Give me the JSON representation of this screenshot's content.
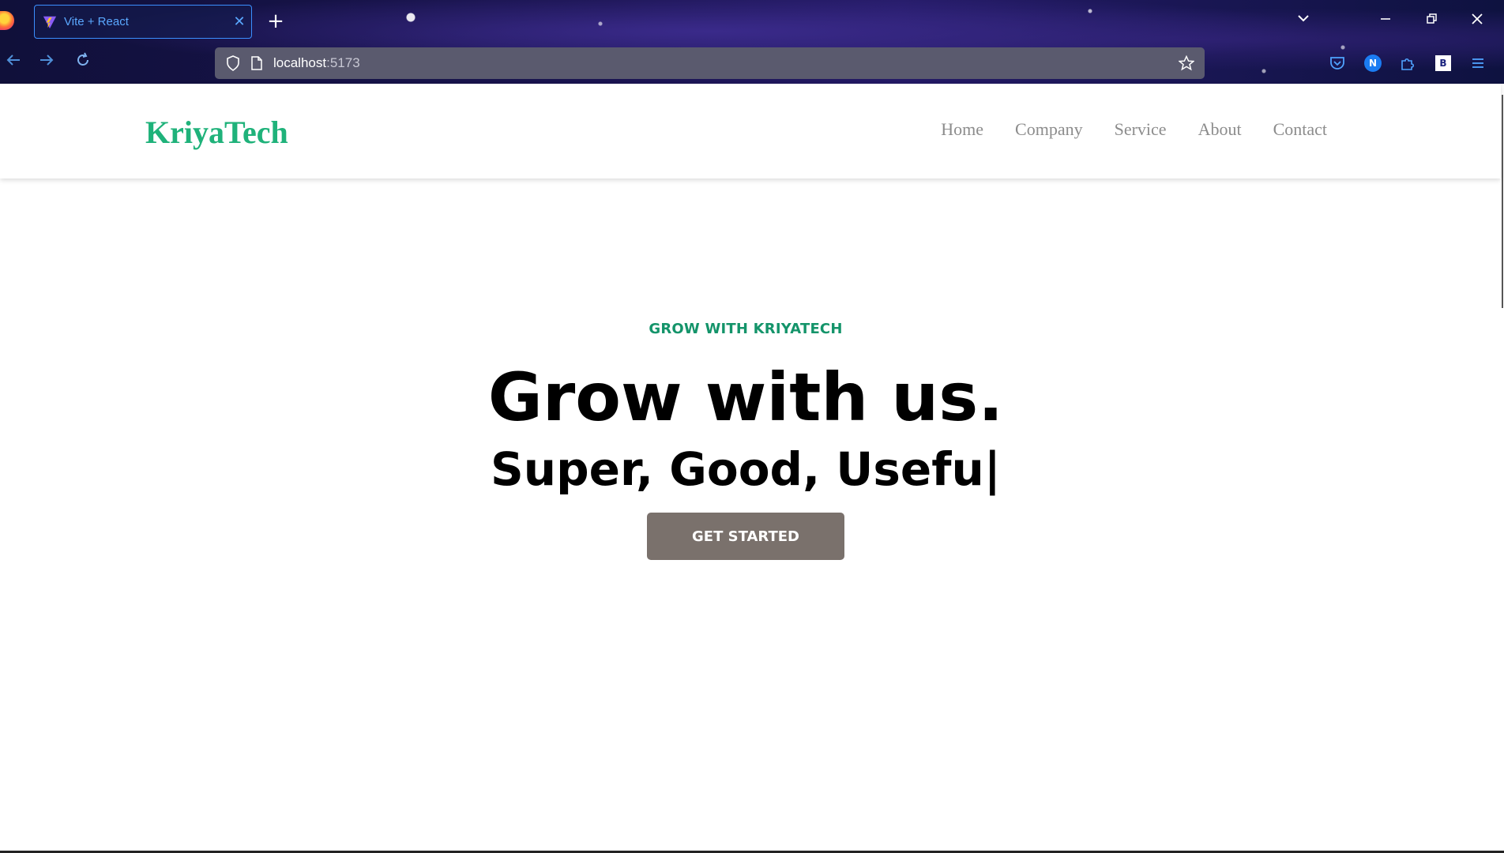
{
  "browser": {
    "tab": {
      "title": "Vite + React",
      "favicon": "vite-icon",
      "close_glyph": "✕"
    },
    "new_tab_glyph": "+",
    "url": {
      "host": "localhost",
      "port": ":5173"
    },
    "extensions": {
      "n_badge": "N",
      "b_badge": "B"
    },
    "accent_color": "#3b8fff"
  },
  "site": {
    "brand": "KriyaTech",
    "brand_color": "#1fb27a",
    "nav": [
      {
        "label": "Home"
      },
      {
        "label": "Company"
      },
      {
        "label": "Service"
      },
      {
        "label": "About"
      },
      {
        "label": "Contact"
      }
    ]
  },
  "hero": {
    "eyebrow": "GROW WITH KRIYATECH",
    "eyebrow_color": "#14946a",
    "headline": "Grow with us.",
    "typed_text": "Super, Good, Usefu|",
    "cta_label": "GET STARTED",
    "cta_color": "#7a716c"
  }
}
